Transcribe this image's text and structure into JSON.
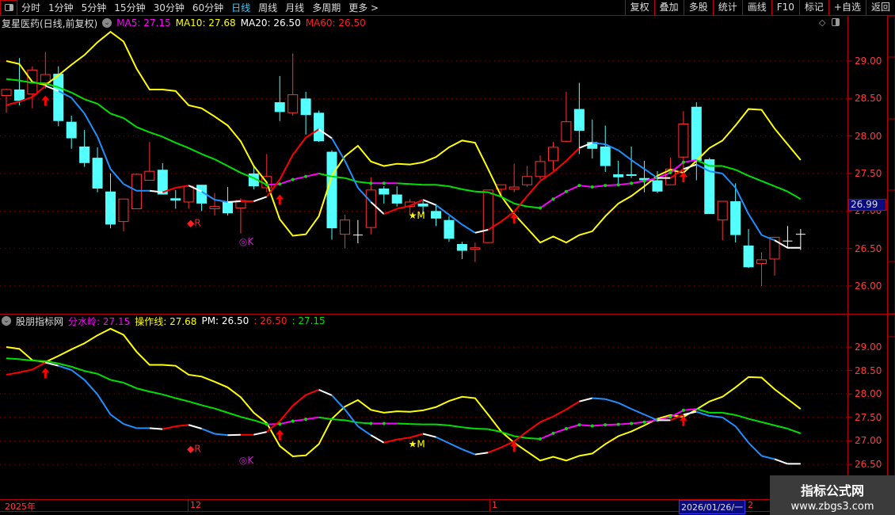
{
  "toolbar": {
    "periods": [
      "分时",
      "1分钟",
      "5分钟",
      "15分钟",
      "30分钟",
      "60分钟",
      "日线",
      "周线",
      "月线",
      "多周期",
      "更多 >"
    ],
    "active_period": "日线",
    "right_buttons": [
      "复权",
      "叠加",
      "多股",
      "统计",
      "画线",
      "F10",
      "标记",
      "+自选",
      "返回"
    ]
  },
  "main_panel": {
    "title": "复星医药(日线,前复权)",
    "ma5": "MA5: 27.15",
    "ma10": "MA10: 27.68",
    "ma20": "MA20: 26.50",
    "ma60": "MA60: 26.50",
    "axis_labels": [
      "29.00",
      "28.50",
      "28.00",
      "27.50",
      "27.00",
      "26.50",
      "26.00"
    ],
    "current_price": "26.99"
  },
  "indicator_panel": {
    "title": "股朋指标网",
    "fsl": "分水岭: 27.15",
    "czx": "操作线: 27.68",
    "pm": "PM: 26.50",
    "v1": ": 26.50",
    "v2": ": 27.15",
    "axis_labels": [
      "29.00",
      "28.50",
      "28.00",
      "27.50",
      "27.00",
      "26.50"
    ]
  },
  "date_axis": {
    "year": "2025年",
    "m12": "12",
    "m1": "1",
    "selected_date": "2026/01/26/一",
    "m2": "2"
  },
  "watermark": {
    "line1": "指标公式网",
    "line2": "www.zbgs3.com"
  },
  "colors": {
    "up": "#ff3232",
    "down": "#54ffff",
    "yellow": "#ffff00",
    "green": "#00e000",
    "magenta": "#ff00ff",
    "blue": "#1e90ff",
    "red": "#ff0000",
    "white": "#ffffff"
  },
  "chart_data": {
    "type": "candlestick",
    "candles": [
      [
        28.54,
        28.63,
        28.31,
        28.62
      ],
      [
        28.62,
        29.04,
        28.41,
        28.47
      ],
      [
        28.56,
        28.93,
        28.37,
        28.88
      ],
      [
        28.71,
        29.12,
        28.63,
        28.82
      ],
      [
        28.83,
        28.93,
        28.13,
        28.2
      ],
      [
        28.19,
        28.27,
        27.83,
        27.97
      ],
      [
        27.86,
        28.08,
        27.59,
        27.64
      ],
      [
        27.71,
        27.85,
        27.25,
        27.3
      ],
      [
        27.26,
        27.5,
        26.77,
        26.82
      ],
      [
        26.86,
        27.16,
        26.73,
        27.16
      ],
      [
        27.03,
        27.5,
        27.03,
        27.49
      ],
      [
        27.41,
        27.92,
        27.41,
        27.53
      ],
      [
        27.55,
        27.64,
        27.22,
        27.22
      ],
      [
        27.17,
        27.28,
        27.03,
        27.14
      ],
      [
        27.12,
        27.33,
        27.03,
        27.33
      ],
      [
        27.35,
        27.35,
        27.0,
        27.1
      ],
      [
        27.03,
        27.24,
        26.94,
        27.06
      ],
      [
        27.12,
        27.32,
        26.94,
        26.97
      ],
      [
        27.04,
        27.17,
        26.7,
        27.14
      ],
      [
        27.5,
        27.6,
        27.29,
        27.33
      ],
      [
        27.31,
        27.76,
        27.25,
        27.46
      ],
      [
        28.45,
        28.8,
        28.2,
        28.32
      ],
      [
        28.31,
        29.1,
        28.27,
        28.55
      ],
      [
        28.5,
        28.59,
        28.02,
        28.28
      ],
      [
        28.31,
        28.34,
        27.92,
        27.93
      ],
      [
        27.79,
        27.81,
        26.62,
        26.77
      ],
      [
        26.69,
        26.95,
        26.5,
        26.88
      ],
      [
        26.68,
        26.88,
        26.57,
        26.68
      ],
      [
        26.78,
        27.45,
        26.69,
        27.28
      ],
      [
        27.3,
        27.33,
        27.1,
        27.22
      ],
      [
        27.22,
        27.33,
        27.06,
        27.1
      ],
      [
        27.06,
        27.16,
        26.96,
        27.12
      ],
      [
        27.1,
        27.13,
        26.96,
        27.06
      ],
      [
        27.0,
        27.09,
        26.8,
        26.9
      ],
      [
        26.88,
        26.93,
        26.59,
        26.63
      ],
      [
        26.56,
        26.59,
        26.36,
        26.47
      ],
      [
        26.5,
        26.58,
        26.32,
        26.51
      ],
      [
        26.58,
        27.28,
        26.58,
        27.28
      ],
      [
        27.29,
        27.35,
        27.2,
        27.35
      ],
      [
        27.29,
        27.63,
        27.25,
        27.32
      ],
      [
        27.35,
        27.6,
        27.32,
        27.46
      ],
      [
        27.46,
        27.74,
        27.42,
        27.66
      ],
      [
        27.67,
        27.92,
        27.54,
        27.85
      ],
      [
        27.93,
        28.59,
        27.92,
        28.19
      ],
      [
        28.36,
        28.71,
        27.76,
        28.07
      ],
      [
        27.92,
        28.22,
        27.7,
        27.83
      ],
      [
        27.86,
        28.14,
        27.52,
        27.6
      ],
      [
        27.49,
        27.67,
        27.35,
        27.45
      ],
      [
        27.49,
        27.86,
        27.44,
        27.47
      ],
      [
        27.44,
        27.67,
        27.25,
        27.41
      ],
      [
        27.41,
        27.53,
        27.24,
        27.26
      ],
      [
        27.35,
        27.71,
        27.35,
        27.56
      ],
      [
        27.72,
        28.33,
        27.49,
        28.16
      ],
      [
        28.39,
        28.45,
        27.41,
        27.67
      ],
      [
        27.69,
        27.71,
        26.96,
        26.96
      ],
      [
        26.88,
        27.13,
        26.61,
        27.13
      ],
      [
        27.13,
        27.37,
        26.58,
        26.68
      ],
      [
        26.54,
        26.76,
        26.24,
        26.25
      ],
      [
        26.3,
        26.45,
        26.0,
        26.35
      ],
      [
        26.36,
        26.65,
        26.14,
        26.65
      ],
      [
        26.6,
        26.8,
        26.5,
        26.6
      ],
      [
        26.69,
        26.76,
        26.48,
        26.69
      ]
    ],
    "yellow_line": [
      29.0,
      28.96,
      28.72,
      28.68,
      28.81,
      28.95,
      29.08,
      29.25,
      29.39,
      29.26,
      28.9,
      28.62,
      28.62,
      28.6,
      28.41,
      28.37,
      28.26,
      28.14,
      27.93,
      27.6,
      27.38,
      26.89,
      26.67,
      26.69,
      26.93,
      27.47,
      27.73,
      27.87,
      27.66,
      27.6,
      27.63,
      27.62,
      27.65,
      27.72,
      27.85,
      27.94,
      27.91,
      27.56,
      27.2,
      26.96,
      26.77,
      26.58,
      26.66,
      26.58,
      26.68,
      26.73,
      26.93,
      27.1,
      27.2,
      27.33,
      27.47,
      27.55,
      27.51,
      27.67,
      27.84,
      27.94,
      28.14,
      28.36,
      28.35,
      28.1,
      27.89,
      27.68
    ],
    "watershed_line": [
      28.76,
      28.74,
      28.71,
      28.7,
      28.65,
      28.58,
      28.49,
      28.43,
      28.3,
      28.24,
      28.12,
      28.05,
      27.99,
      27.91,
      27.84,
      27.76,
      27.69,
      27.6,
      27.51,
      27.44,
      27.35,
      27.36,
      27.42,
      27.46,
      27.5,
      27.46,
      27.44,
      27.39,
      27.37,
      27.37,
      27.37,
      27.36,
      27.35,
      27.35,
      27.33,
      27.29,
      27.26,
      27.25,
      27.19,
      27.1,
      27.06,
      27.04,
      27.16,
      27.26,
      27.34,
      27.32,
      27.34,
      27.35,
      27.37,
      27.4,
      27.44,
      27.51,
      27.65,
      27.68,
      27.6,
      27.6,
      27.55,
      27.47,
      27.4,
      27.33,
      27.26,
      27.16
    ],
    "watershed_magenta_ranges": [
      [
        20,
        24
      ],
      [
        28,
        30
      ],
      [
        41,
        53
      ]
    ],
    "pm_line": [
      28.41,
      28.46,
      28.52,
      28.67,
      28.6,
      28.51,
      28.3,
      27.99,
      27.56,
      27.36,
      27.27,
      27.27,
      27.25,
      27.31,
      27.34,
      27.26,
      27.15,
      27.12,
      27.13,
      27.13,
      27.19,
      27.42,
      27.75,
      27.98,
      28.09,
      27.97,
      27.67,
      27.31,
      27.12,
      26.96,
      27.03,
      27.07,
      27.15,
      27.08,
      26.95,
      26.82,
      26.71,
      26.75,
      26.86,
      26.99,
      27.2,
      27.4,
      27.52,
      27.67,
      27.84,
      27.91,
      27.89,
      27.81,
      27.68,
      27.56,
      27.44,
      27.44,
      27.56,
      27.62,
      27.53,
      27.5,
      27.31,
      26.96,
      26.68,
      26.61,
      26.51,
      26.51
    ],
    "pm_segment_colors": "rrrwbbbbbbbwrrwbbwrwrrrrwbbbwrrrwbbbwrrrrrrrwbbbbbwrwbbbbbbww",
    "up_arrows": [
      [
        3,
        28.52
      ],
      [
        21,
        27.2
      ],
      [
        39,
        26.95
      ],
      [
        52,
        27.5
      ]
    ],
    "signals": [
      {
        "index": 14,
        "price": 26.85,
        "label": "◆R",
        "color": "#ff2020"
      },
      {
        "index": 18,
        "price": 26.6,
        "label": "◎K",
        "color": "#cc22cc"
      },
      {
        "index": 31,
        "price": 26.95,
        "label": "★M",
        "color": "#ffff00"
      }
    ],
    "ylim_main": [
      25.8,
      29.4
    ],
    "ylim_indicator": [
      26.3,
      29.3
    ]
  }
}
